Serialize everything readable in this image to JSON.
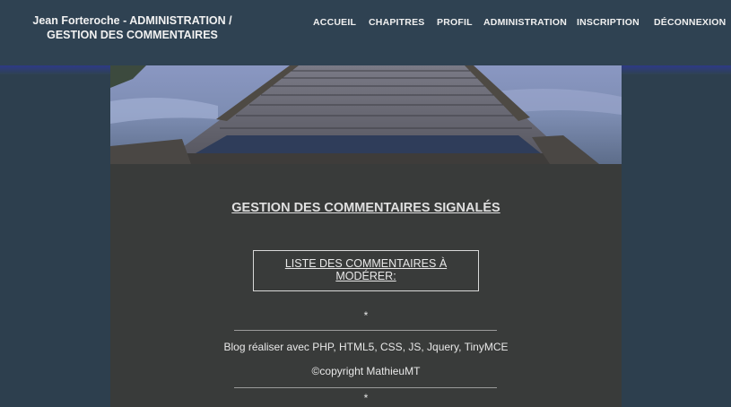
{
  "header": {
    "title_line1": "Jean Forteroche - ADMINISTRATION /",
    "title_line2": "GESTION DES COMMENTAIRES"
  },
  "nav": {
    "accueil": "ACCUEIL",
    "chapitres": "CHAPITRES",
    "profil": "PROFIL",
    "administration": "ADMINISTRATION",
    "inscription": "INSCRIPTION",
    "deconnexion": "DÉCONNEXION"
  },
  "main": {
    "heading": "GESTION DES COMMENTAIRES SIGNALÉS",
    "moderation_box_label": "LISTE DES COMMENTAIRES À MODÉRER:"
  },
  "footer": {
    "separator": "*",
    "made_with": "Blog réaliser avec PHP, HTML5, CSS, JS, Jquery, TinyMCE",
    "copyright": "©copyright MathieuMT"
  },
  "colors": {
    "page_background": "#2d3f4e",
    "content_background": "#393b3a",
    "accent_strip": "#2d3a86"
  }
}
